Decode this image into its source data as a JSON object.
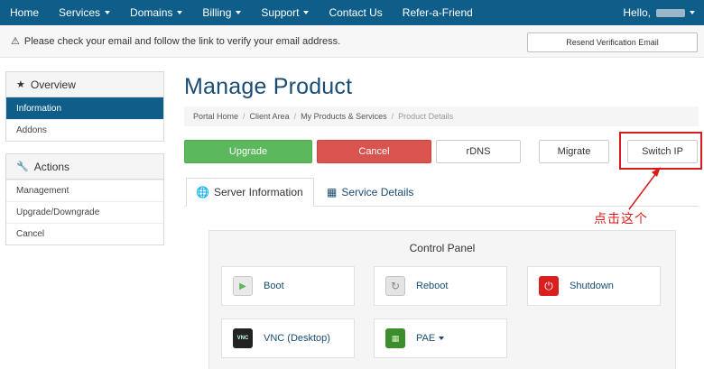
{
  "nav": {
    "items": [
      {
        "label": "Home",
        "dropdown": false
      },
      {
        "label": "Services",
        "dropdown": true
      },
      {
        "label": "Domains",
        "dropdown": true
      },
      {
        "label": "Billing",
        "dropdown": true
      },
      {
        "label": "Support",
        "dropdown": true
      },
      {
        "label": "Contact Us",
        "dropdown": false
      },
      {
        "label": "Refer-a-Friend",
        "dropdown": false
      }
    ],
    "hello": "Hello,"
  },
  "verify": {
    "message": "Please check your email and follow the link to verify your email address.",
    "resend_label": "Resend Verification Email"
  },
  "sidebar": {
    "overview": {
      "title": "Overview",
      "items": [
        {
          "label": "Information",
          "active": true
        },
        {
          "label": "Addons",
          "active": false
        }
      ]
    },
    "actions": {
      "title": "Actions",
      "items": [
        {
          "label": "Management"
        },
        {
          "label": "Upgrade/Downgrade"
        },
        {
          "label": "Cancel"
        }
      ]
    }
  },
  "page": {
    "title": "Manage Product",
    "breadcrumb": [
      "Portal Home",
      "Client Area",
      "My Products & Services",
      "Product Details"
    ]
  },
  "buttons": {
    "upgrade": "Upgrade",
    "cancel": "Cancel",
    "rdns": "rDNS",
    "migrate": "Migrate",
    "switch_ip": "Switch IP"
  },
  "tabs": [
    {
      "label": "Server Information",
      "active": true,
      "icon": "globe-icon"
    },
    {
      "label": "Service Details",
      "active": false,
      "icon": "cubes-icon"
    }
  ],
  "annotation": "点击这个",
  "control_panel": {
    "title": "Control Panel",
    "buttons": [
      {
        "label": "Boot",
        "icon": "boot-icon"
      },
      {
        "label": "Reboot",
        "icon": "reboot-icon"
      },
      {
        "label": "Shutdown",
        "icon": "power-icon"
      },
      {
        "label": "VNC (Desktop)",
        "icon": "vnc-icon",
        "icon_text": "VNC"
      },
      {
        "label": "PAE",
        "icon": "memory-icon",
        "dropdown": true
      }
    ]
  },
  "colors": {
    "nav_bg": "#0f5e8a",
    "accent_green": "#5cb85c",
    "accent_red": "#d9534f",
    "highlight_red": "#d91a1a"
  }
}
